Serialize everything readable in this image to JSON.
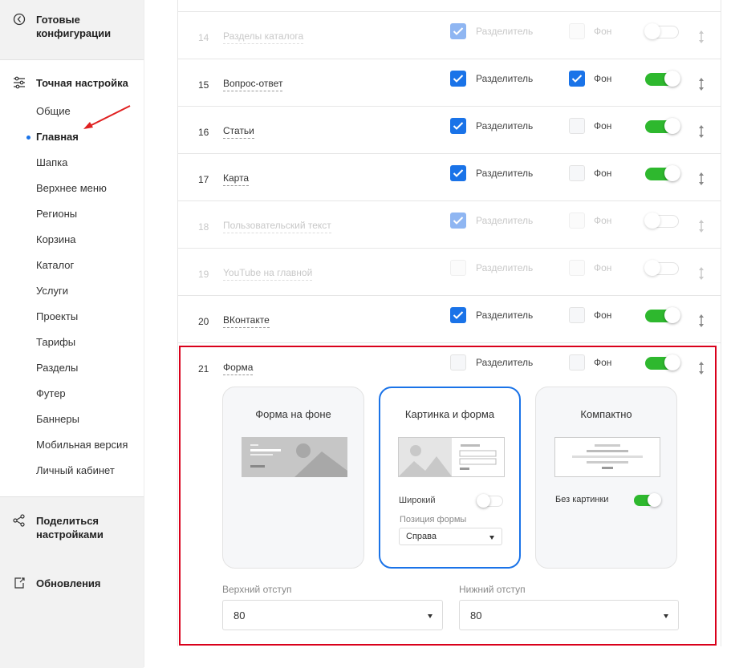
{
  "sidebar": {
    "top_item": "Готовые конфигурации",
    "section": "Точная настройка",
    "items": [
      "Общие",
      "Главная",
      "Шапка",
      "Верхнее меню",
      "Регионы",
      "Корзина",
      "Каталог",
      "Услуги",
      "Проекты",
      "Тарифы",
      "Разделы",
      "Футер",
      "Баннеры",
      "Мобильная версия",
      "Личный кабинет"
    ],
    "active_item": "Главная",
    "share": "Поделиться настройками",
    "updates": "Обновления"
  },
  "rows": [
    {
      "num": "14",
      "title": "Разделы каталога",
      "divider_label": "Разделитель",
      "divider": true,
      "bg_label": "Фон",
      "bg": false,
      "enabled": false
    },
    {
      "num": "15",
      "title": "Вопрос-ответ",
      "divider_label": "Разделитель",
      "divider": true,
      "bg_label": "Фон",
      "bg": true,
      "enabled": true
    },
    {
      "num": "16",
      "title": "Статьи",
      "divider_label": "Разделитель",
      "divider": true,
      "bg_label": "Фон",
      "bg": false,
      "enabled": true
    },
    {
      "num": "17",
      "title": "Карта",
      "divider_label": "Разделитель",
      "divider": true,
      "bg_label": "Фон",
      "bg": false,
      "enabled": true
    },
    {
      "num": "18",
      "title": "Пользовательский текст",
      "divider_label": "Разделитель",
      "divider": true,
      "bg_label": "Фон",
      "bg": false,
      "enabled": false
    },
    {
      "num": "19",
      "title": "YouTube на главной",
      "divider_label": "Разделитель",
      "divider": false,
      "bg_label": "Фон",
      "bg": false,
      "enabled": false
    },
    {
      "num": "20",
      "title": "ВКонтакте",
      "divider_label": "Разделитель",
      "divider": true,
      "bg_label": "Фон",
      "bg": false,
      "enabled": true
    },
    {
      "num": "21",
      "title": "Форма",
      "divider_label": "Разделитель",
      "divider": false,
      "bg_label": "Фон",
      "bg": false,
      "enabled": true
    }
  ],
  "form_options": {
    "cards": [
      {
        "title": "Форма на фоне",
        "selected": false
      },
      {
        "title": "Картинка и форма",
        "selected": true,
        "wide_label": "Широкий",
        "wide": false,
        "position_label": "Позиция формы",
        "position_value": "Справа"
      },
      {
        "title": "Компактно",
        "selected": false,
        "no_image_label": "Без картинки",
        "no_image": true
      }
    ],
    "top_padding_label": "Верхний отступ",
    "top_padding_value": "80",
    "bottom_padding_label": "Нижний отступ",
    "bottom_padding_value": "80"
  },
  "colors": {
    "accent": "#1a73e8",
    "toggle_on": "#2eb82e",
    "highlight": "#d9001b",
    "annotation": "#e02020"
  }
}
